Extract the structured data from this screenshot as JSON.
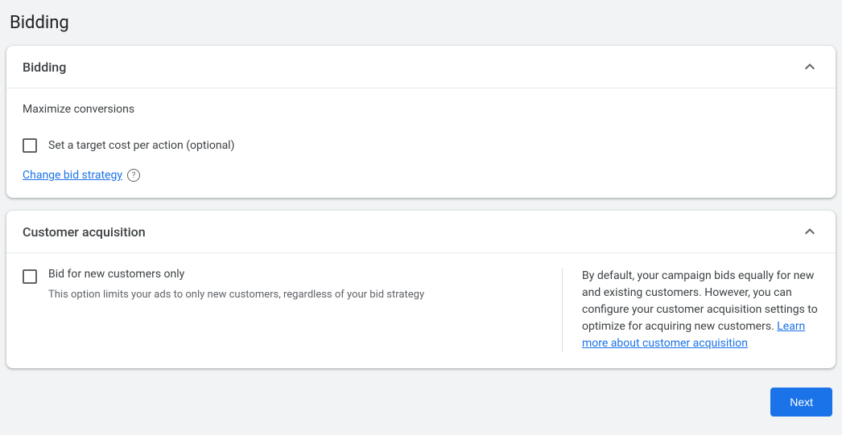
{
  "page": {
    "title": "Bidding"
  },
  "bidding_card": {
    "title": "Bidding",
    "strategy": "Maximize conversions",
    "target_cpa_checkbox_label": "Set a target cost per action (optional)",
    "change_link": "Change bid strategy"
  },
  "acquisition_card": {
    "title": "Customer acquisition",
    "checkbox_title": "Bid for new customers only",
    "checkbox_desc": "This option limits your ads to only new customers, regardless of your bid strategy",
    "info_text_before": "By default, your campaign bids equally for new and existing customers. However, you can configure your customer acquisition settings to optimize for acquiring new customers. ",
    "info_link": "Learn more about customer acquisition"
  },
  "footer": {
    "next_label": "Next"
  }
}
